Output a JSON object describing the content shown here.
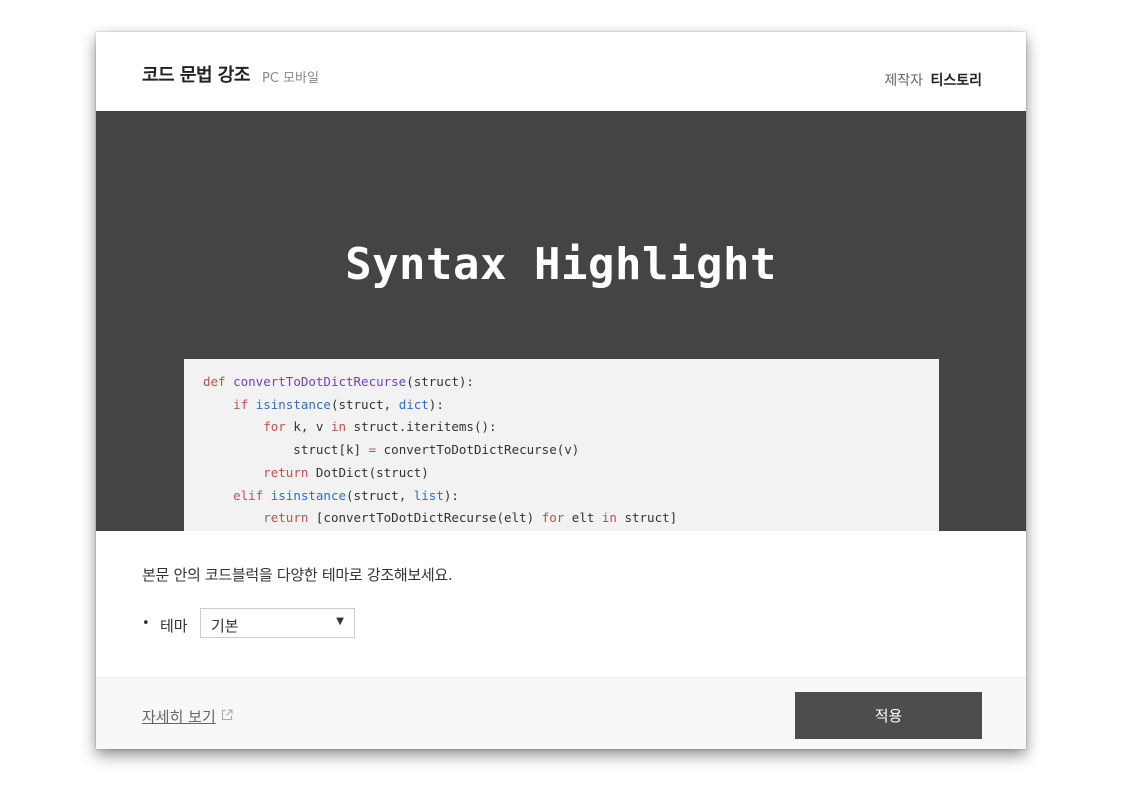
{
  "header": {
    "title": "코드 문법 강조",
    "platform": "PC 모바일",
    "maker_label": "제작자",
    "maker_name": "티스토리"
  },
  "preview": {
    "heading": "Syntax Highlight",
    "code_lines": [
      [
        [
          "kw",
          "def "
        ],
        [
          "fn",
          "convertToDotDictRecurse"
        ],
        [
          "",
          "(struct):"
        ]
      ],
      [
        [
          "",
          "    "
        ],
        [
          "kw",
          "if "
        ],
        [
          "bi",
          "isinstance"
        ],
        [
          "",
          "(struct, "
        ],
        [
          "bi",
          "dict"
        ],
        [
          "",
          "):"
        ]
      ],
      [
        [
          "",
          "        "
        ],
        [
          "kw",
          "for "
        ],
        [
          "",
          "k, v "
        ],
        [
          "kw",
          "in "
        ],
        [
          "",
          "struct.iteritems():"
        ]
      ],
      [
        [
          "",
          "            struct[k] "
        ],
        [
          "op",
          "= "
        ],
        [
          "",
          "convertToDotDictRecurse(v)"
        ]
      ],
      [
        [
          "",
          "        "
        ],
        [
          "kw",
          "return "
        ],
        [
          "",
          "DotDict(struct)"
        ]
      ],
      [
        [
          "",
          "    "
        ],
        [
          "kw",
          "elif "
        ],
        [
          "bi",
          "isinstance"
        ],
        [
          "",
          "(struct, "
        ],
        [
          "bi",
          "list"
        ],
        [
          "",
          "):"
        ]
      ],
      [
        [
          "",
          "        "
        ],
        [
          "kw",
          "return "
        ],
        [
          "",
          "[convertToDotDictRecurse(elt) "
        ],
        [
          "kw",
          "for "
        ],
        [
          "",
          "elt "
        ],
        [
          "kw",
          "in "
        ],
        [
          "",
          "struct]"
        ]
      ]
    ]
  },
  "body": {
    "description": "본문 안의 코드블럭을 다양한 테마로 강조해보세요.",
    "bullet": "•",
    "theme_label": "테마",
    "theme_value": "기본",
    "caret": "▼"
  },
  "footer": {
    "more_link": "자세히 보기",
    "apply_label": "적용"
  },
  "colors": {
    "preview_bg": "#444444",
    "keyword": "#c0504d",
    "function": "#6f42c1",
    "builtin": "#2f6fc1",
    "button_bg": "#4d4d4d"
  },
  "icons": {
    "external_link": "external-link-icon",
    "dropdown": "chevron-down-icon"
  }
}
